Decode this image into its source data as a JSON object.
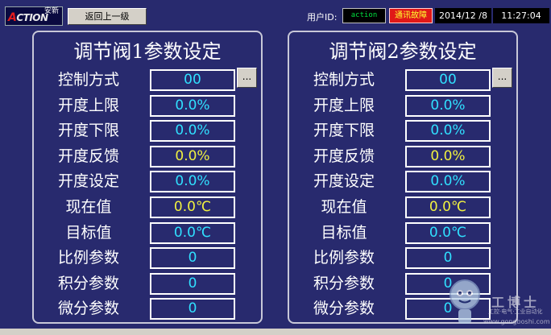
{
  "header": {
    "logo_cn": "安新",
    "logo_en": "ACTION",
    "back_button": "返回上一级",
    "user_id_label": "用户ID:",
    "user_id_value": "action",
    "fault_label": "通讯故障",
    "date": "2014/12 /8",
    "time": "11:27:04"
  },
  "colors": {
    "background": "#282a6e",
    "value_cyan": "#30e0ff",
    "value_yellow": "#f0f040",
    "fault_bg": "#e01818"
  },
  "panels": [
    {
      "title": "调节阀1参数设定",
      "dots_button": "...",
      "rows": [
        {
          "label": "控制方式",
          "value": "00",
          "color": "cyan"
        },
        {
          "label": "开度上限",
          "value": "0.0%",
          "color": "cyan"
        },
        {
          "label": "开度下限",
          "value": "0.0%",
          "color": "cyan"
        },
        {
          "label": "开度反馈",
          "value": "0.0%",
          "color": "yellow"
        },
        {
          "label": "开度设定",
          "value": "0.0%",
          "color": "cyan"
        },
        {
          "label": "现在值",
          "value": "0.0℃",
          "color": "yellow"
        },
        {
          "label": "目标值",
          "value": "0.0℃",
          "color": "cyan"
        },
        {
          "label": "比例参数",
          "value": "0",
          "color": "cyan"
        },
        {
          "label": "积分参数",
          "value": "0",
          "color": "cyan"
        },
        {
          "label": "微分参数",
          "value": "0",
          "color": "cyan"
        }
      ]
    },
    {
      "title": "调节阀2参数设定",
      "dots_button": "...",
      "rows": [
        {
          "label": "控制方式",
          "value": "00",
          "color": "cyan"
        },
        {
          "label": "开度上限",
          "value": "0.0%",
          "color": "cyan"
        },
        {
          "label": "开度下限",
          "value": "0.0%",
          "color": "cyan"
        },
        {
          "label": "开度反馈",
          "value": "0.0%",
          "color": "yellow"
        },
        {
          "label": "开度设定",
          "value": "0.0%",
          "color": "cyan"
        },
        {
          "label": "现在值",
          "value": "0.0℃",
          "color": "yellow"
        },
        {
          "label": "目标值",
          "value": "0.0℃",
          "color": "cyan"
        },
        {
          "label": "比例参数",
          "value": "0",
          "color": "cyan"
        },
        {
          "label": "积分参数",
          "value": "0",
          "color": "cyan"
        },
        {
          "label": "微分参数",
          "value": "0",
          "color": "cyan"
        }
      ]
    }
  ],
  "watermark": {
    "title": "工博士",
    "subtitle": "工控·电气·工业自动化",
    "url": "www.gongboshi.com",
    "icon": "mascot-icon"
  }
}
